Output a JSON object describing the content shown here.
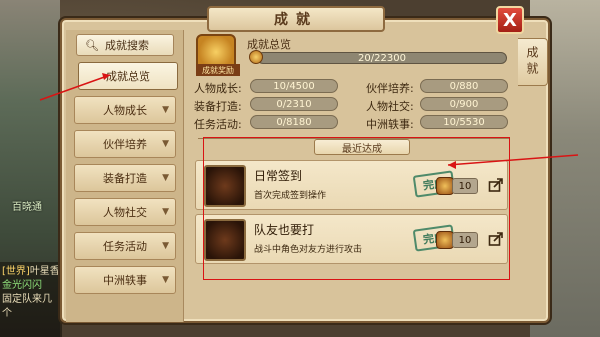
{
  "window": {
    "title": "成就",
    "side_tag": "成就",
    "close_label": "X"
  },
  "menu": {
    "search_label": "成就搜索",
    "items": [
      {
        "label": "成就总览",
        "active": true
      },
      {
        "label": "人物成长"
      },
      {
        "label": "伙伴培养"
      },
      {
        "label": "装备打造"
      },
      {
        "label": "人物社交"
      },
      {
        "label": "任务活动"
      },
      {
        "label": "中洲轶事"
      }
    ]
  },
  "overview": {
    "badge_label": "成就奖励",
    "title": "成就总览",
    "progress_text": "20/22300",
    "progress_fraction": 0.001,
    "stats": [
      {
        "label": "人物成长:",
        "value": "10/4500"
      },
      {
        "label": "伙伴培养:",
        "value": "0/880"
      },
      {
        "label": "装备打造:",
        "value": "0/2310"
      },
      {
        "label": "人物社交:",
        "value": "0/900"
      },
      {
        "label": "任务活动:",
        "value": "0/8180"
      },
      {
        "label": "中洲轶事:",
        "value": "10/5530"
      }
    ]
  },
  "recent": {
    "title": "最近达成",
    "items": [
      {
        "name": "日常签到",
        "desc": "首次完成签到操作",
        "status": "完成",
        "reward": "10"
      },
      {
        "name": "队友也要打",
        "desc": "战斗中角色对友方进行攻击",
        "status": "完成",
        "reward": "10"
      }
    ]
  },
  "background": {
    "npc_name": "百晓通",
    "chat_lines": [
      {
        "tag": "世界",
        "text": "叶星香"
      },
      {
        "tag": "",
        "text": "金光闪闪"
      },
      {
        "tag": "",
        "text": "固定队来几个"
      }
    ]
  }
}
